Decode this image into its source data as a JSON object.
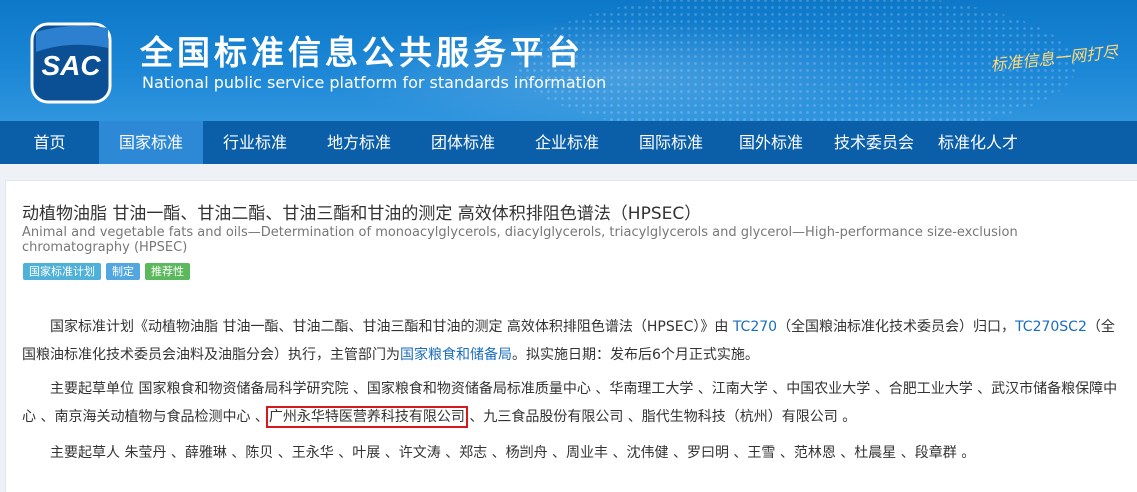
{
  "header": {
    "logo_text": "SAC",
    "title": "全国标准信息公共服务平台",
    "subtitle": "National public service platform  for standards information",
    "slogan": "标准信息一网打尽"
  },
  "nav": {
    "items": [
      "首页",
      "国家标准",
      "行业标准",
      "地方标准",
      "团体标准",
      "企业标准",
      "国际标准",
      "国外标准",
      "技术委员会",
      "标准化人才"
    ],
    "active_index": 1
  },
  "standard": {
    "title": "动植物油脂 甘油一酯、甘油二酯、甘油三酯和甘油的测定 高效体积排阻色谱法（HPSEC）",
    "title_en": "Animal and vegetable fats and oils—Determination of monoacylglycerols, diacylglycerols, triacylglycerols and glycerol—High-performance size-exclusion chromatography (HPSEC)",
    "tags": [
      {
        "label": "国家标准计划",
        "color": "#4fb0d8"
      },
      {
        "label": "制定",
        "color": "#52a7e0"
      },
      {
        "label": "推荐性",
        "color": "#5cb85c"
      }
    ]
  },
  "description": {
    "p1_prefix": "国家标准计划《动植物油脂 甘油一酯、甘油二酯、甘油三酯和甘油的测定 高效体积排阻色谱法（HPSEC）》由 ",
    "tc_link": "TC270",
    "tc_name": "（全国粮油标准化技术委员会）归口，",
    "sc_link": "TC270SC2",
    "sc_name": "（全国粮油标准化技术委员会油料及油脂分会）执行，主管部门为",
    "dept_link": "国家粮食和储备局",
    "p1_suffix": "。拟实施日期：发布后6个月正式实施。",
    "units_prefix": "主要起草单位 国家粮食和物资储备局科学研究院 、国家粮食和物资储备局标准质量中心 、华南理工大学 、江南大学 、中国农业大学 、合肥工业大学 、武汉市储备粮保障中心 、南京海关动植物与食品检测中心 、",
    "units_highlight": "广州永华特医营养科技有限公司",
    "units_suffix": " 、九三食品股份有限公司 、脂代生物科技（杭州）有限公司 。",
    "drafters": "主要起草人 朱莹丹 、薛雅琳 、陈贝 、王永华 、叶展 、许文涛 、郑志 、杨剀舟 、周业丰 、沈伟健 、罗曰明 、王雪 、范林恩 、杜晨星 、段章群 。"
  }
}
